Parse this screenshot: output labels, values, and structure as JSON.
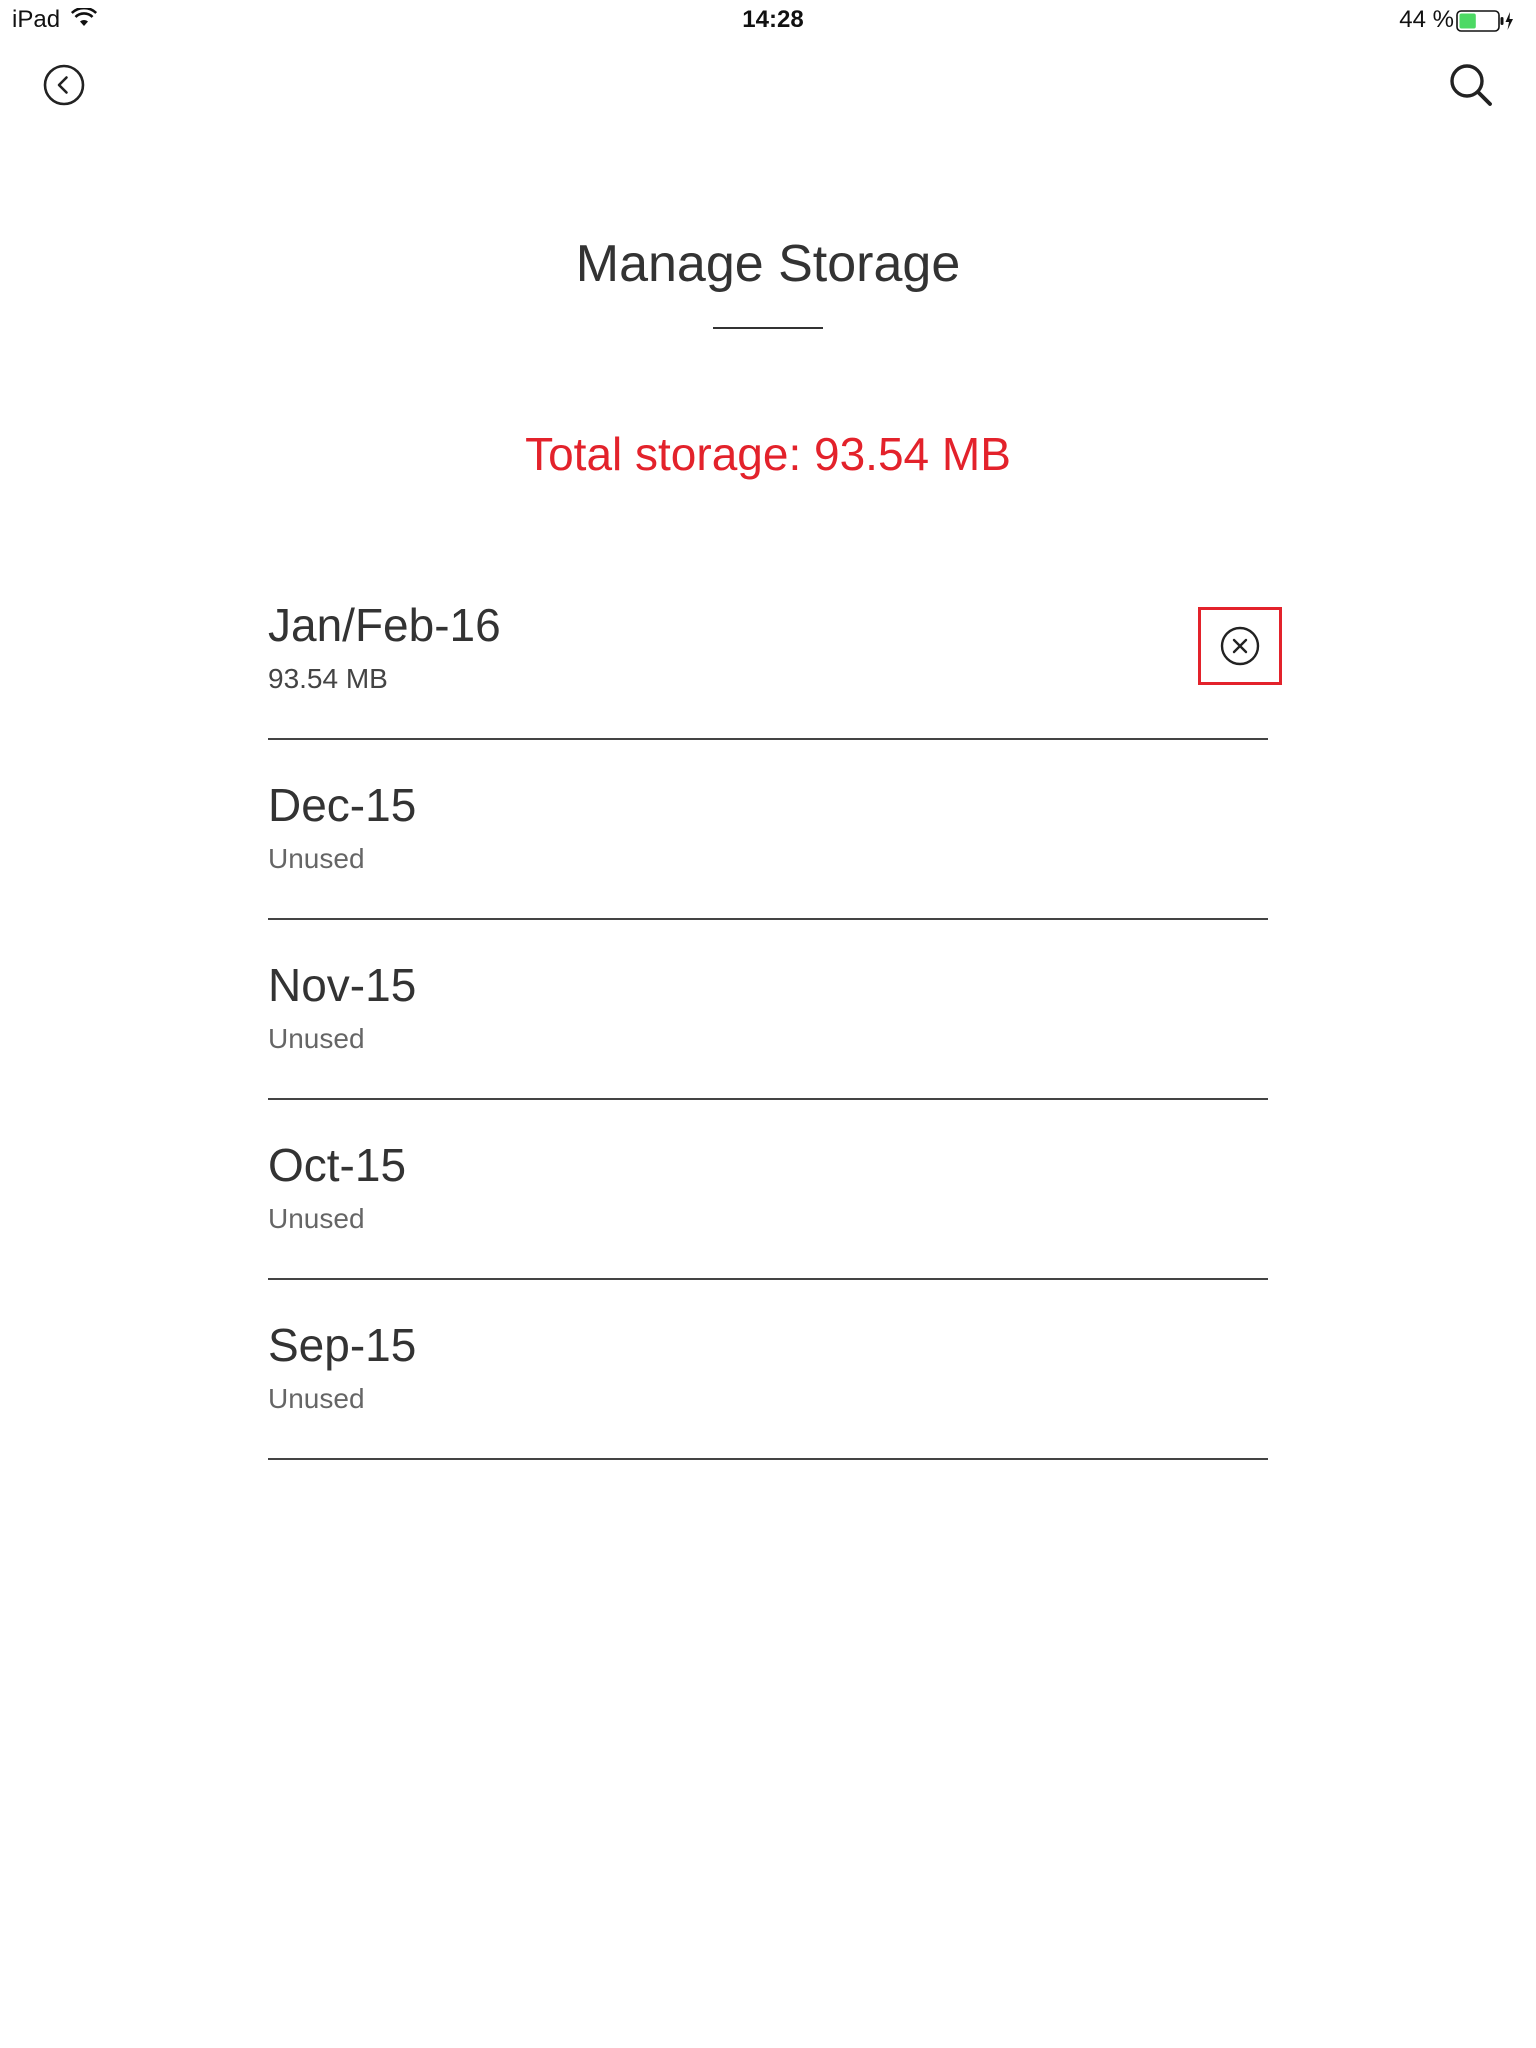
{
  "status_bar": {
    "device": "iPad",
    "time": "14:28",
    "battery_percent": "44 %",
    "battery_level": 0.44,
    "battery_color": "#4cd964",
    "wifi_icon": "wifi-icon",
    "charging_icon": "bolt-icon"
  },
  "nav": {
    "back_icon": "chevron-left-circle-icon",
    "search_icon": "search-icon"
  },
  "page": {
    "title": "Manage Storage",
    "total_storage": "Total storage: 93.54 MB",
    "accent_color": "#e3222b"
  },
  "items": [
    {
      "title": "Jan/Feb-16",
      "subtitle": "93.54 MB",
      "delete_icon": "close-circle-icon"
    },
    {
      "title": "Dec-15",
      "subtitle": "Unused"
    },
    {
      "title": "Nov-15",
      "subtitle": "Unused"
    },
    {
      "title": "Oct-15",
      "subtitle": "Unused"
    },
    {
      "title": "Sep-15",
      "subtitle": "Unused"
    }
  ]
}
